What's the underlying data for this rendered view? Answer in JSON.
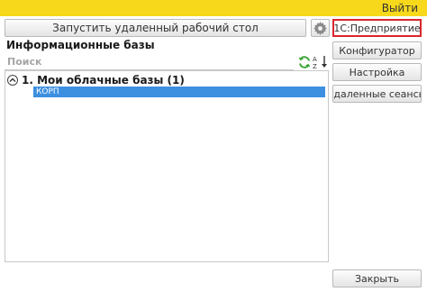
{
  "topbar": {
    "exit_label": "Выйти",
    "color": "#f7d81b"
  },
  "toolbar": {
    "remote_desktop_label": "Запустить удаленный рабочий стол",
    "gear_icon": "gear-icon"
  },
  "side_buttons": {
    "enterprise": "1С:Предприятие",
    "configurator": "Конфигуратор",
    "settings": "Настройка",
    "remote_sessions": "Удаленные сеансы",
    "close": "Закрыть"
  },
  "infobases": {
    "title": "Информационные базы",
    "search_placeholder": "Поиск",
    "refresh_icon": "refresh-icon",
    "sort_icon": "sort-az-icon",
    "groups": [
      {
        "label": "1. Мои облачные базы (1)",
        "expanded": true,
        "items": [
          {
            "label": "КОРП",
            "selected": true
          }
        ]
      }
    ]
  },
  "colors": {
    "selection": "#3d8fe0",
    "highlight_border": "#d9262c"
  }
}
